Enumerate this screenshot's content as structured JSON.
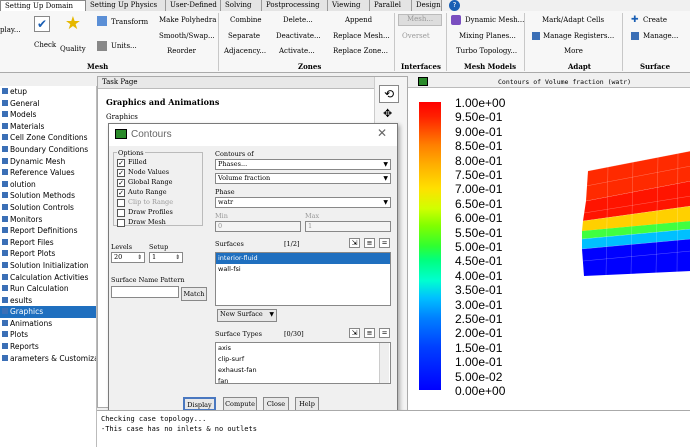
{
  "tabs": [
    "Setting Up Domain",
    "Setting Up Physics",
    "User-Defined",
    "Solving",
    "Postprocessing",
    "Viewing",
    "Parallel",
    "Design"
  ],
  "ribbon": {
    "mesh": {
      "display": "play...",
      "check": "Check",
      "quality": "Quality",
      "transform": "Transform",
      "units": "Units...",
      "make_polyhedra": "Make Polyhedra",
      "smooth_swap": "Smooth/Swap...",
      "reorder": "Reorder",
      "title": "Mesh"
    },
    "zones": {
      "combine": "Combine",
      "separate": "Separate",
      "adjacency": "Adjacency...",
      "delete": "Delete...",
      "deactivate": "Deactivate...",
      "activate": "Activate...",
      "append": "Append",
      "replace_mesh": "Replace Mesh...",
      "replace_zone": "Replace Zone...",
      "title": "Zones"
    },
    "interfaces": {
      "mesh": "Mesh...",
      "overset": "Overset",
      "title": "Interfaces"
    },
    "mesh_models": {
      "dynamic_mesh": "Dynamic Mesh...",
      "mixing_planes": "Mixing Planes...",
      "turbo_topology": "Turbo Topology...",
      "title": "Mesh Models"
    },
    "adapt": {
      "mark_adapt": "Mark/Adapt Cells",
      "manage_registers": "Manage Registers...",
      "more": "More",
      "title": "Adapt"
    },
    "surface": {
      "create": "Create",
      "manage": "Manage...",
      "title": "Surface"
    }
  },
  "tree": [
    {
      "label": "etup",
      "sel": false
    },
    {
      "label": "General",
      "sel": false
    },
    {
      "label": "Models",
      "sel": false
    },
    {
      "label": "Materials",
      "sel": false
    },
    {
      "label": "Cell Zone Conditions",
      "sel": false
    },
    {
      "label": "Boundary Conditions",
      "sel": false
    },
    {
      "label": "Dynamic Mesh",
      "sel": false
    },
    {
      "label": "Reference Values",
      "sel": false
    },
    {
      "label": "olution",
      "sel": false
    },
    {
      "label": "Solution Methods",
      "sel": false
    },
    {
      "label": "Solution Controls",
      "sel": false
    },
    {
      "label": "Monitors",
      "sel": false
    },
    {
      "label": "Report Definitions",
      "sel": false
    },
    {
      "label": "Report Files",
      "sel": false
    },
    {
      "label": "Report Plots",
      "sel": false
    },
    {
      "label": "Solution Initialization",
      "sel": false
    },
    {
      "label": "Calculation Activities",
      "sel": false
    },
    {
      "label": "Run Calculation",
      "sel": false
    },
    {
      "label": "esults",
      "sel": false
    },
    {
      "label": "Graphics",
      "sel": true
    },
    {
      "label": "Animations",
      "sel": false
    },
    {
      "label": "Plots",
      "sel": false
    },
    {
      "label": "Reports",
      "sel": false
    },
    {
      "label": "arameters & Customizat...",
      "sel": false
    }
  ],
  "taskpage": {
    "header": "Task Page",
    "title": "Graphics and Animations",
    "sub": "Graphics"
  },
  "dialog": {
    "title": "Contours",
    "options_label": "Options",
    "options": [
      {
        "label": "Filled",
        "checked": true
      },
      {
        "label": "Node Values",
        "checked": true
      },
      {
        "label": "Global Range",
        "checked": true
      },
      {
        "label": "Auto Range",
        "checked": true
      },
      {
        "label": "Clip to Range",
        "checked": false
      },
      {
        "label": "Draw Profiles",
        "checked": false
      },
      {
        "label": "Draw Mesh",
        "checked": false
      }
    ],
    "contours_of": "Contours of",
    "contours_val1": "Phases...",
    "contours_val2": "Volume fraction",
    "phase_label": "Phase",
    "phase_val": "watr",
    "min_label": "Min",
    "max_label": "Max",
    "min_val": "0",
    "max_val": "1",
    "surfaces_label": "Surfaces",
    "surfaces_count": "[1/2]",
    "surfaces": [
      {
        "name": "interior-fluid",
        "sel": true
      },
      {
        "name": "wall-fsi",
        "sel": false
      }
    ],
    "levels_label": "Levels",
    "levels_val": "20",
    "setup_label": "Setup",
    "setup_val": "1",
    "pattern_label": "Surface Name Pattern",
    "match": "Match",
    "new_surface": "New Surface",
    "types_label": "Surface Types",
    "types_count": "[0/30]",
    "types": [
      "axis",
      "clip-surf",
      "exhaust-fan",
      "fan"
    ],
    "buttons": [
      "Display",
      "Compute",
      "Close",
      "Help"
    ]
  },
  "graphics": {
    "title": "Contours of Volume fraction (watr)",
    "colorbar": [
      "1.00e+00",
      "9.50e-01",
      "9.00e-01",
      "8.50e-01",
      "8.00e-01",
      "7.50e-01",
      "7.00e-01",
      "6.50e-01",
      "6.00e-01",
      "5.50e-01",
      "5.00e-01",
      "4.50e-01",
      "4.00e-01",
      "3.50e-01",
      "3.00e-01",
      "2.50e-01",
      "2.00e-01",
      "1.50e-01",
      "1.00e-01",
      "5.00e-02",
      "0.00e+00"
    ]
  },
  "console": [
    "Checking case topology...",
    "-This case has no inlets & no outlets"
  ]
}
